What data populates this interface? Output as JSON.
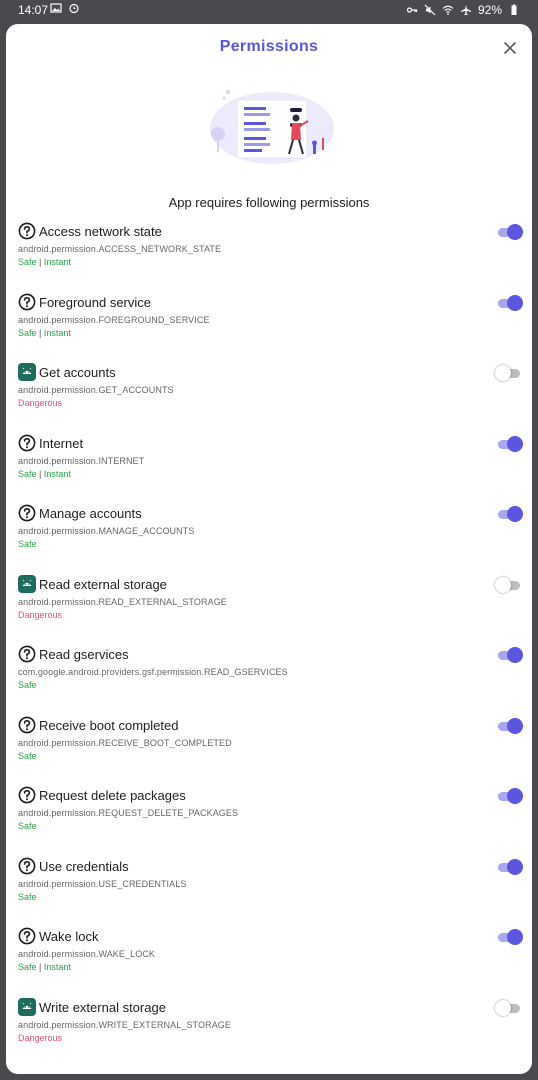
{
  "status_bar": {
    "time": "14:07",
    "left_icons": [
      "gallery-icon",
      "alarm-icon"
    ],
    "right_icons": [
      "vpn-key-icon",
      "mute-icon",
      "wifi-icon",
      "airplane-icon"
    ],
    "battery": "92%"
  },
  "dialog": {
    "title": "Permissions",
    "subtitle": "App requires following permissions",
    "close_icon": "close-icon"
  },
  "colors": {
    "accent": "#5b55df",
    "safe": "#2aa44a",
    "dangerous": "#e0547a",
    "android_badge": "#1f6b5e"
  },
  "permissions": [
    {
      "label": "Access network state",
      "id": "android.permission.ACCESS_NETWORK_STATE",
      "level": "Safe",
      "extra": "Instant",
      "icon": "help-circle-icon",
      "enabled": true
    },
    {
      "label": "Foreground service",
      "id": "android.permission.FOREGROUND_SERVICE",
      "level": "Safe",
      "extra": "Instant",
      "icon": "help-circle-icon",
      "enabled": true
    },
    {
      "label": "Get accounts",
      "id": "android.permission.GET_ACCOUNTS",
      "level": "Dangerous",
      "extra": "",
      "icon": "android-icon",
      "enabled": false
    },
    {
      "label": "Internet",
      "id": "android.permission.INTERNET",
      "level": "Safe",
      "extra": "Instant",
      "icon": "help-circle-icon",
      "enabled": true
    },
    {
      "label": "Manage accounts",
      "id": "android.permission.MANAGE_ACCOUNTS",
      "level": "Safe",
      "extra": "",
      "icon": "help-circle-icon",
      "enabled": true
    },
    {
      "label": "Read external storage",
      "id": "android.permission.READ_EXTERNAL_STORAGE",
      "level": "Dangerous",
      "extra": "",
      "icon": "android-icon",
      "enabled": false
    },
    {
      "label": "Read gservices",
      "id": "com.google.android.providers.gsf.permission.READ_GSERVICES",
      "level": "Safe",
      "extra": "",
      "icon": "help-circle-icon",
      "enabled": true
    },
    {
      "label": "Receive boot completed",
      "id": "android.permission.RECEIVE_BOOT_COMPLETED",
      "level": "Safe",
      "extra": "",
      "icon": "help-circle-icon",
      "enabled": true
    },
    {
      "label": "Request delete packages",
      "id": "android.permission.REQUEST_DELETE_PACKAGES",
      "level": "Safe",
      "extra": "",
      "icon": "help-circle-icon",
      "enabled": true
    },
    {
      "label": "Use credentials",
      "id": "android.permission.USE_CREDENTIALS",
      "level": "Safe",
      "extra": "",
      "icon": "help-circle-icon",
      "enabled": true
    },
    {
      "label": "Wake lock",
      "id": "android.permission.WAKE_LOCK",
      "level": "Safe",
      "extra": "Instant",
      "icon": "help-circle-icon",
      "enabled": true
    },
    {
      "label": "Write external storage",
      "id": "android.permission.WRITE_EXTERNAL_STORAGE",
      "level": "Dangerous",
      "extra": "",
      "icon": "android-icon",
      "enabled": false
    }
  ]
}
